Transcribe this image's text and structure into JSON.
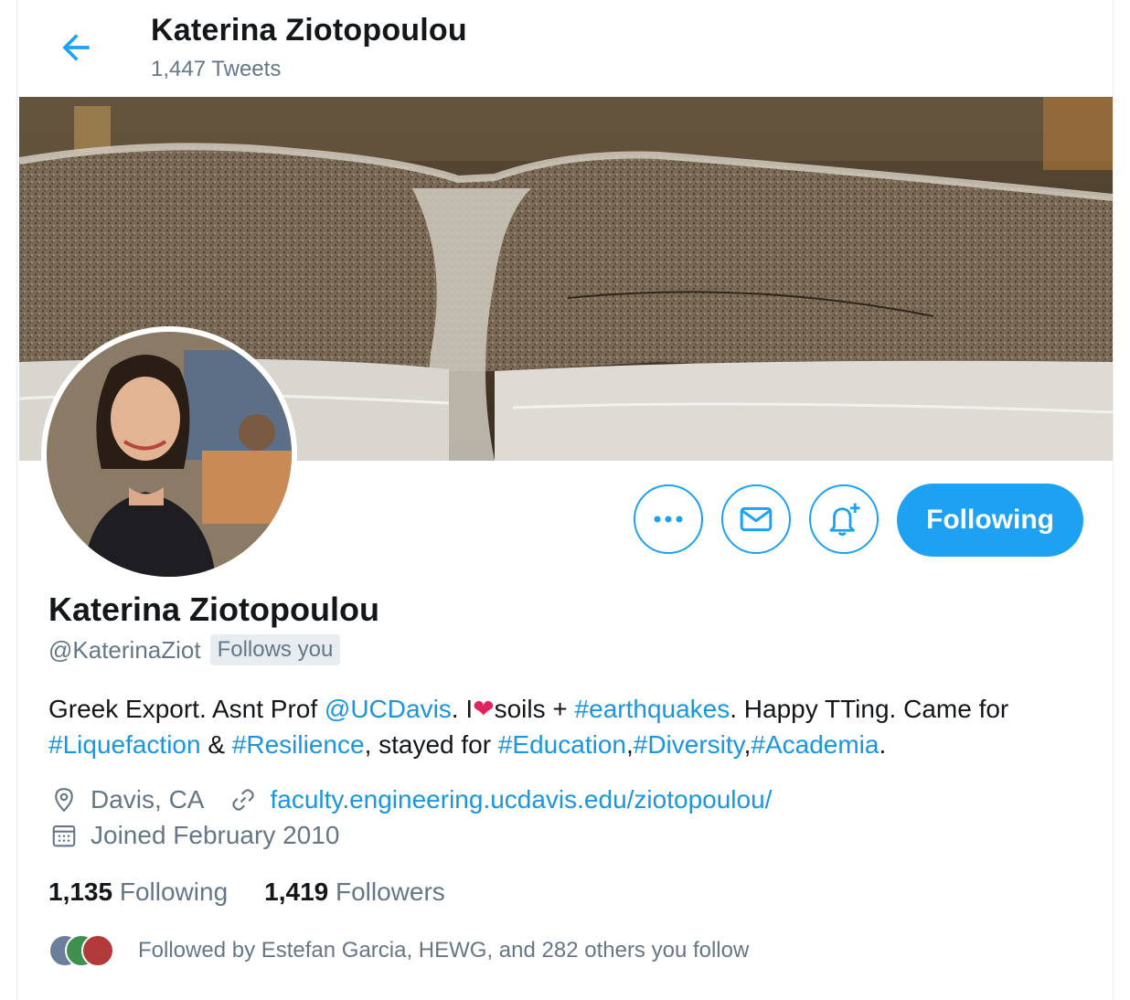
{
  "header": {
    "title": "Katerina Ziotopoulou",
    "tweet_count": "1,447 Tweets"
  },
  "profile": {
    "name": "Katerina Ziotopoulou",
    "handle": "@KaterinaZiot",
    "follows_you": "Follows you",
    "bio": {
      "p1": "Greek Export. Asnt Prof ",
      "mention": "@UCDavis",
      "p2": ". I",
      "heart": "❤",
      "p3": "soils + ",
      "tag_earthquakes": "#earthquakes",
      "p4": ". Happy TTing. Came for ",
      "tag_liquefaction": "#Liquefaction",
      "p5": " & ",
      "tag_resilience": "#Resilience",
      "p6": ", stayed for ",
      "tag_education": "#Education",
      "p7": ",",
      "tag_diversity": "#Diversity",
      "p8": ",",
      "tag_academia": "#Academia",
      "p9": "."
    },
    "location": "Davis, CA",
    "website": "faculty.engineering.ucdavis.edu/ziotopoulou/",
    "joined": "Joined February 2010",
    "following_count": "1,135",
    "following_label": "Following",
    "followers_count": "1,419",
    "followers_label": "Followers",
    "followed_by": "Followed by Estefan Garcia, HEWG, and 282 others you follow"
  },
  "actions": {
    "more": "•••",
    "follow_state": "Following"
  },
  "icons": [
    "back-arrow-icon",
    "more-icon",
    "mail-icon",
    "bell-plus-icon",
    "location-pin-icon",
    "link-icon",
    "calendar-icon"
  ],
  "colors": {
    "accent": "#1da1f2",
    "link": "#1b95e0",
    "muted": "#657786",
    "heart": "#e0245e"
  }
}
